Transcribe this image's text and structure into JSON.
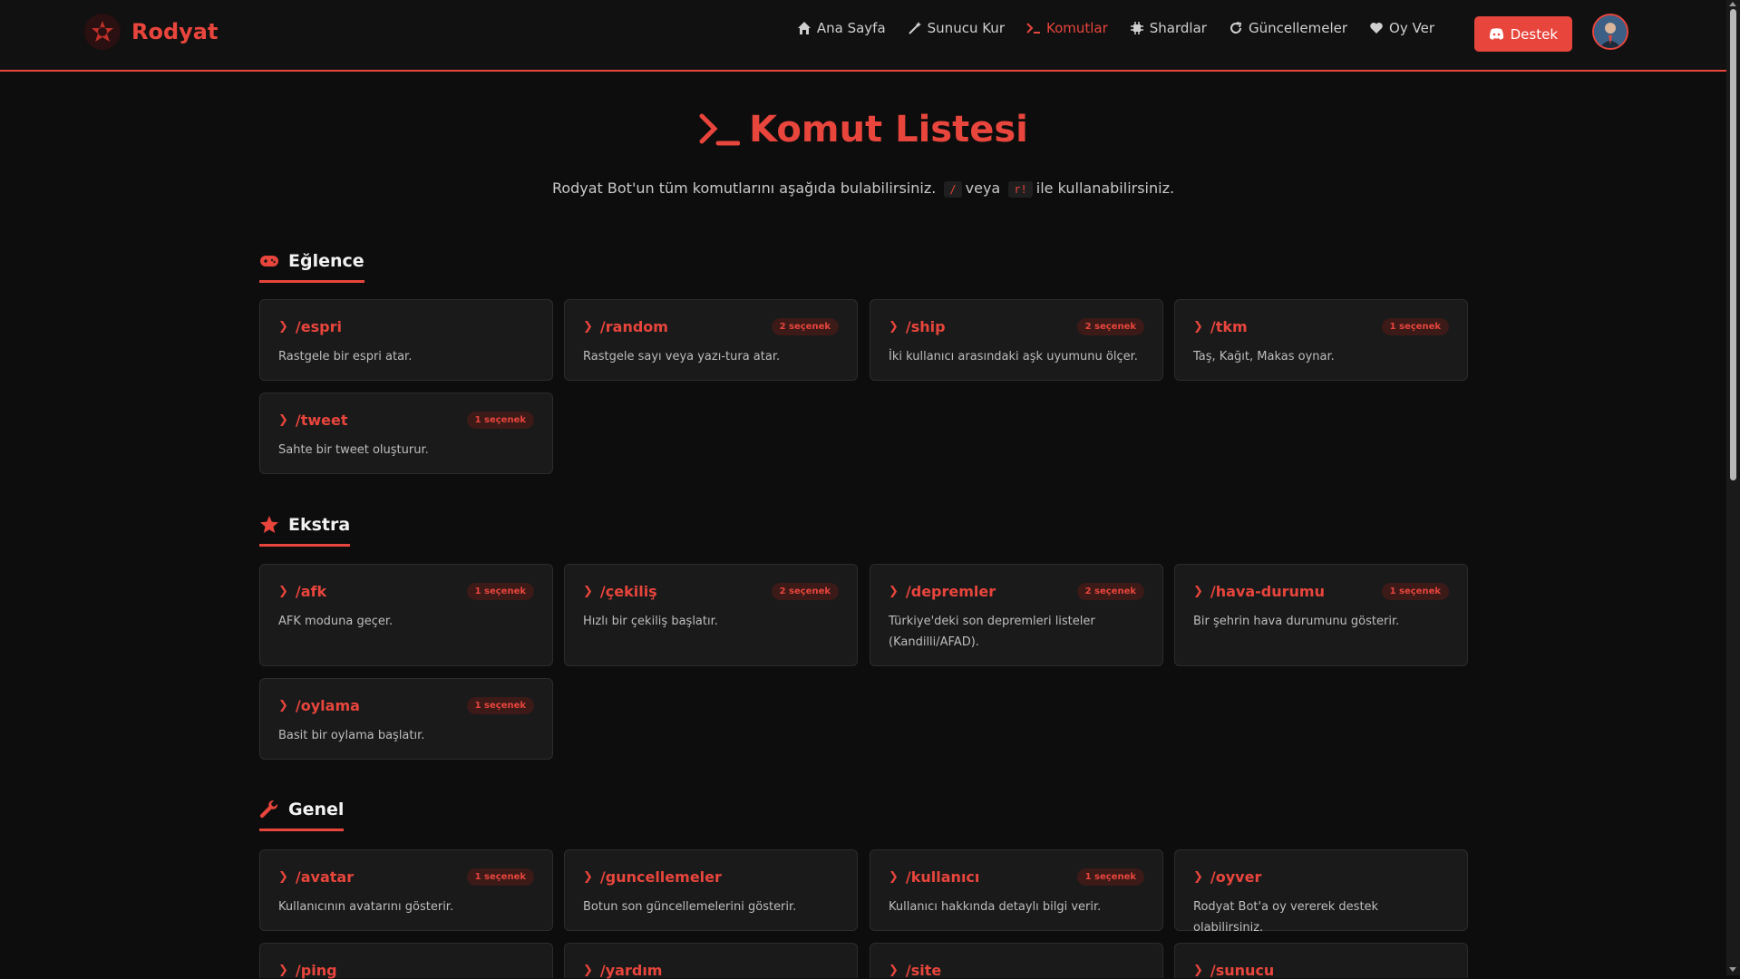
{
  "brand": {
    "name": "Rodyat"
  },
  "nav": {
    "items": [
      {
        "label": "Ana Sayfa",
        "icon": "home-icon"
      },
      {
        "label": "Sunucu Kur",
        "icon": "magic-wand-icon"
      },
      {
        "label": "Komutlar",
        "icon": "terminal-icon",
        "active": true
      },
      {
        "label": "Shardlar",
        "icon": "chip-icon"
      },
      {
        "label": "Güncellemeler",
        "icon": "refresh-icon"
      },
      {
        "label": "Oy Ver",
        "icon": "heart-icon"
      }
    ],
    "support_label": "Destek"
  },
  "hero": {
    "title": "Komut Listesi",
    "subtitle_before": "Rodyat Bot'un tüm komutlarını aşağıda bulabilirsiniz.",
    "code_slash": "/",
    "subtitle_mid": "veya",
    "code_prefix": "r!",
    "subtitle_after": "ile kullanabilirsiniz."
  },
  "sections": {
    "eglence": {
      "title": "Eğlence",
      "icon": "gamepad-icon",
      "cards": [
        {
          "cmd": "/espri",
          "badge": "",
          "desc": "Rastgele bir espri atar."
        },
        {
          "cmd": "/random",
          "badge": "2 seçenek",
          "desc": "Rastgele sayı veya yazı-tura atar."
        },
        {
          "cmd": "/ship",
          "badge": "2 seçenek",
          "desc": "İki kullanıcı arasındaki aşk uyumunu ölçer."
        },
        {
          "cmd": "/tkm",
          "badge": "1 seçenek",
          "desc": "Taş, Kağıt, Makas oynar."
        },
        {
          "cmd": "/tweet",
          "badge": "1 seçenek",
          "desc": "Sahte bir tweet oluşturur."
        }
      ]
    },
    "ekstra": {
      "title": "Ekstra",
      "icon": "star-icon",
      "cards": [
        {
          "cmd": "/afk",
          "badge": "1 seçenek",
          "desc": "AFK moduna geçer."
        },
        {
          "cmd": "/çekiliş",
          "badge": "2 seçenek",
          "desc": "Hızlı bir çekiliş başlatır."
        },
        {
          "cmd": "/depremler",
          "badge": "2 seçenek",
          "desc": "Türkiye'deki son depremleri listeler (Kandilli/AFAD)."
        },
        {
          "cmd": "/hava-durumu",
          "badge": "1 seçenek",
          "desc": "Bir şehrin hava durumunu gösterir."
        },
        {
          "cmd": "/oylama",
          "badge": "1 seçenek",
          "desc": "Basit bir oylama başlatır."
        }
      ]
    },
    "genel": {
      "title": "Genel",
      "icon": "wrench-icon",
      "cards": [
        {
          "cmd": "/avatar",
          "badge": "1 seçenek",
          "desc": "Kullanıcının avatarını gösterir."
        },
        {
          "cmd": "/guncellemeler",
          "badge": "",
          "desc": "Botun son güncellemelerini gösterir."
        },
        {
          "cmd": "/kullanıcı",
          "badge": "1 seçenek",
          "desc": "Kullanıcı hakkında detaylı bilgi verir."
        },
        {
          "cmd": "/oyver",
          "badge": "",
          "desc": "Rodyat Bot'a oy vererek destek olabilirsiniz."
        },
        {
          "cmd": "/ping",
          "badge": "",
          "desc": ""
        },
        {
          "cmd": "/yardım",
          "badge": "",
          "desc": ""
        },
        {
          "cmd": "/site",
          "badge": "",
          "desc": ""
        },
        {
          "cmd": "/sunucu",
          "badge": "",
          "desc": ""
        }
      ]
    }
  },
  "colors": {
    "accent": "#e8453c",
    "background": "#0d0d0d",
    "card": "#1a1a1a"
  }
}
